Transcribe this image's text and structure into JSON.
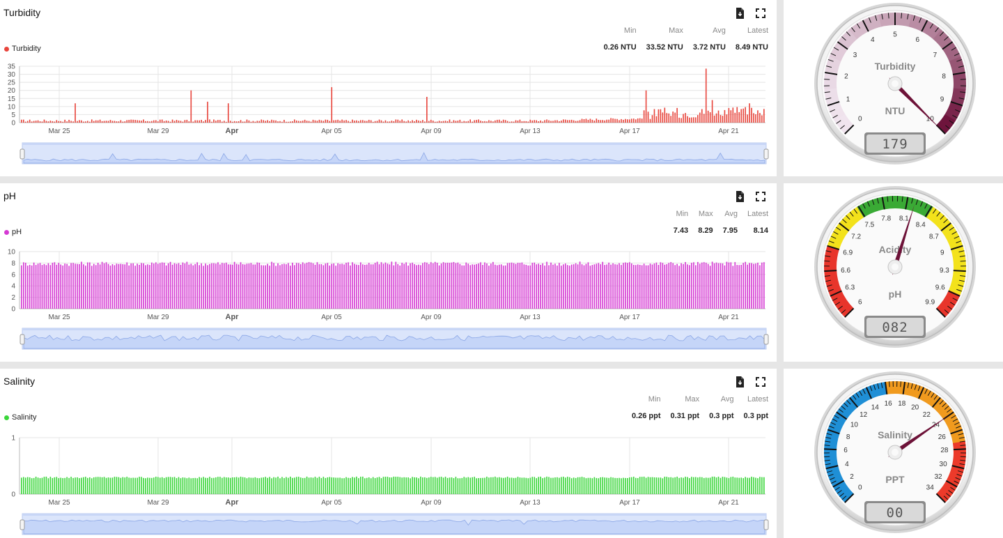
{
  "panels": [
    {
      "id": "turbidity",
      "title": "Turbidity",
      "legend": "Turbidity",
      "color": "#e8453c",
      "stats": {
        "min_label": "Min",
        "max_label": "Max",
        "avg_label": "Avg",
        "latest_label": "Latest",
        "min": "0.26 NTU",
        "max": "33.52 NTU",
        "avg": "3.72 NTU",
        "latest": "8.49 NTU"
      },
      "y_ticks": [
        "35",
        "30",
        "25",
        "20",
        "15",
        "10",
        "5",
        "0"
      ],
      "x_ticks": [
        "Mar 25",
        "Mar 29",
        "Apr",
        "Apr 05",
        "Apr 09",
        "Apr 13",
        "Apr 17",
        "Apr 21"
      ]
    },
    {
      "id": "ph",
      "title": "pH",
      "legend": "pH",
      "color": "#d53ad3",
      "stats": {
        "min_label": "Min",
        "max_label": "Max",
        "avg_label": "Avg",
        "latest_label": "Latest",
        "min": "7.43",
        "max": "8.29",
        "avg": "7.95",
        "latest": "8.14"
      },
      "y_ticks": [
        "10",
        "8",
        "6",
        "4",
        "2",
        "0"
      ],
      "x_ticks": [
        "Mar 25",
        "Mar 29",
        "Apr",
        "Apr 05",
        "Apr 09",
        "Apr 13",
        "Apr 17",
        "Apr 21"
      ]
    },
    {
      "id": "salinity",
      "title": "Salinity",
      "legend": "Salinity",
      "color": "#3ad63a",
      "stats": {
        "min_label": "Min",
        "max_label": "Max",
        "avg_label": "Avg",
        "latest_label": "Latest",
        "min": "0.26 ppt",
        "max": "0.31 ppt",
        "avg": "0.3 ppt",
        "latest": "0.3 ppt"
      },
      "y_ticks": [
        "1",
        "0"
      ],
      "x_ticks": [
        "Mar 25",
        "Mar 29",
        "Apr",
        "Apr 05",
        "Apr 09",
        "Apr 13",
        "Apr 17",
        "Apr 21"
      ]
    }
  ],
  "gauges": [
    {
      "id": "turbidity",
      "label": "Turbidity",
      "unit": "NTU",
      "lcd": "179",
      "ticks": [
        "0",
        "1",
        "2",
        "3",
        "4",
        "5",
        "6",
        "7",
        "8",
        "9",
        "10"
      ],
      "min": 0,
      "max": 10,
      "value": 10
    },
    {
      "id": "ph",
      "label": "Acidity",
      "unit": "pH",
      "lcd": "082",
      "ticks": [
        "6",
        "6.3",
        "6.6",
        "6.9",
        "7.2",
        "7.5",
        "7.8",
        "8.1",
        "8.4",
        "8.7",
        "9",
        "9.3",
        "9.6",
        "9.9"
      ],
      "min": 6,
      "max": 9.9,
      "value": 8.2
    },
    {
      "id": "salinity",
      "label": "Salinity",
      "unit": "PPT",
      "lcd": "00",
      "ticks": [
        "0",
        "2",
        "4",
        "6",
        "8",
        "10",
        "12",
        "14",
        "16",
        "18",
        "20",
        "22",
        "24",
        "26",
        "28",
        "30",
        "32",
        "34"
      ],
      "min": 0,
      "max": 34,
      "value": 24
    }
  ],
  "chart_data": [
    {
      "type": "bar",
      "title": "Turbidity",
      "ylim": [
        0,
        35
      ],
      "series": [
        {
          "name": "Turbidity",
          "values_summary": {
            "min": 0.26,
            "max": 33.52,
            "avg": 3.72,
            "latest": 8.49
          }
        }
      ]
    },
    {
      "type": "bar",
      "title": "pH",
      "ylim": [
        0,
        10
      ],
      "series": [
        {
          "name": "pH",
          "values_summary": {
            "min": 7.43,
            "max": 8.29,
            "avg": 7.95,
            "latest": 8.14
          }
        }
      ]
    },
    {
      "type": "bar",
      "title": "Salinity",
      "ylim": [
        0,
        1
      ],
      "series": [
        {
          "name": "Salinity",
          "values_summary": {
            "min": 0.26,
            "max": 0.31,
            "avg": 0.3,
            "latest": 0.3
          }
        }
      ]
    }
  ]
}
